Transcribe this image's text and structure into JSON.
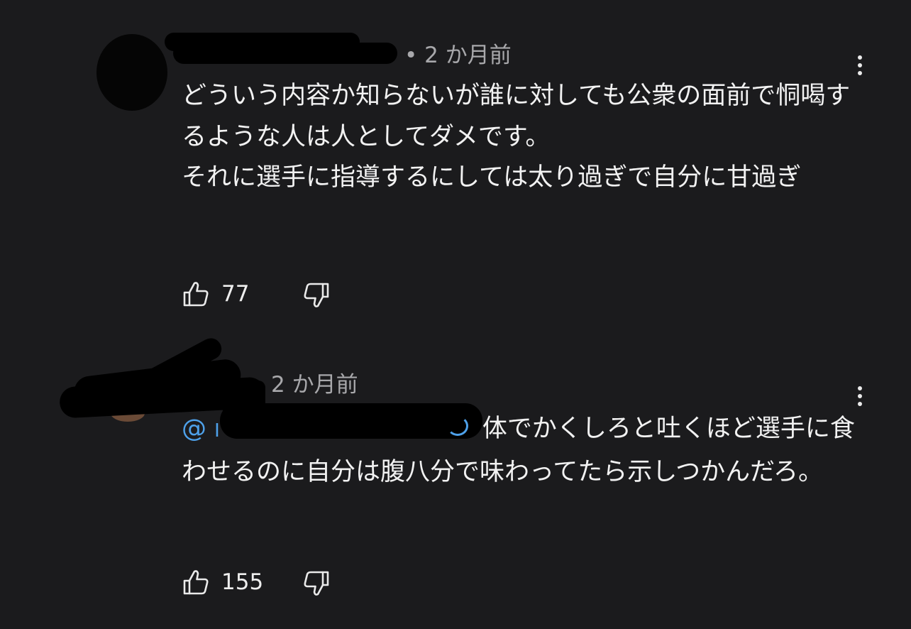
{
  "comments": [
    {
      "time": "• 2 か月前",
      "text": "どういう内容か知らないが誰に対しても公衆の面前で恫喝するような人は人としてダメです。\nそれに選手に指導するにしては太り過ぎで自分に甘過ぎ",
      "likes": "77",
      "icons": {
        "like": "thumbs-up-icon",
        "dislike": "thumbs-down-icon",
        "menu": "more-vert-icon"
      }
    },
    {
      "time": "2 か月前",
      "mention_prefix": "@",
      "mention_partial": "I",
      "text": "体でかくしろと吐くほど選手に食わせるのに自分は腹八分で味わってたら示しつかんだろ。",
      "likes": "155",
      "icons": {
        "like": "thumbs-up-icon",
        "dislike": "thumbs-down-icon",
        "menu": "more-vert-icon"
      }
    }
  ],
  "colors": {
    "background": "#1b1b1d",
    "text": "#f2f2f2",
    "secondary": "#a8a8ab",
    "mention": "#4ea1ea"
  }
}
